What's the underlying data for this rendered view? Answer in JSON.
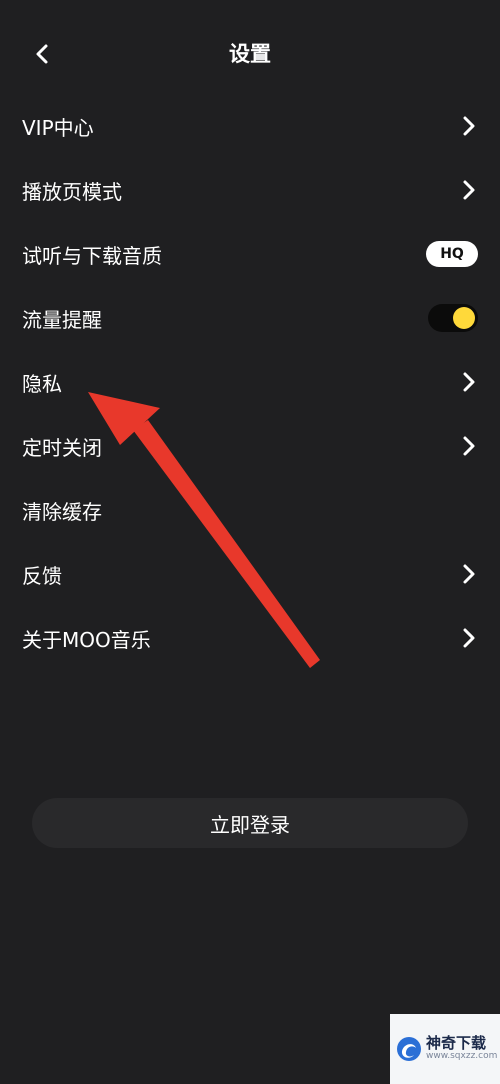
{
  "header": {
    "title": "设置"
  },
  "rows": [
    {
      "label": "VIP中心",
      "control": "chevron"
    },
    {
      "label": "播放页模式",
      "control": "chevron"
    },
    {
      "label": "试听与下载音质",
      "control": "badge",
      "badge": "HQ"
    },
    {
      "label": "流量提醒",
      "control": "toggle",
      "toggle_on": true
    },
    {
      "label": "隐私",
      "control": "chevron"
    },
    {
      "label": "定时关闭",
      "control": "chevron"
    },
    {
      "label": "清除缓存",
      "control": "none"
    },
    {
      "label": "反馈",
      "control": "chevron"
    },
    {
      "label": "关于MOO音乐",
      "control": "chevron"
    }
  ],
  "login_button": {
    "label": "立即登录"
  },
  "watermark": {
    "title": "神奇下载",
    "url": "www.sqxzz.com"
  },
  "colors": {
    "background": "#1f1f21",
    "toggle_knob": "#ffd93a",
    "annotation_arrow": "#e8382b",
    "button_bg": "#29292b"
  }
}
